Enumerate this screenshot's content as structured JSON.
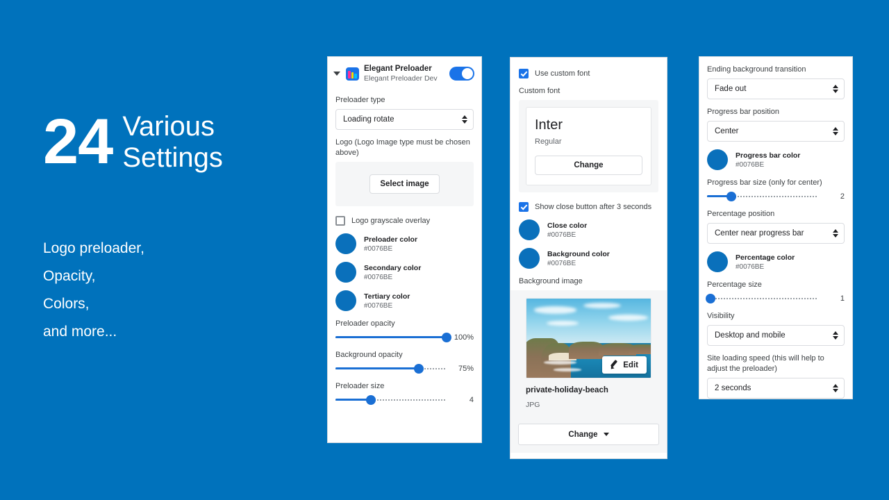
{
  "promo": {
    "number": "24",
    "title_line1": "Various",
    "title_line2": "Settings",
    "features": [
      "Logo preloader,",
      "Opacity,",
      "Colors,",
      "and more..."
    ]
  },
  "theme": {
    "background": "#0072BC",
    "accent": "#1a73e8",
    "swatch": "#0076BE"
  },
  "panel1": {
    "header": {
      "caret_icon": "chevron-down-icon",
      "app_icon": "elegant-preloader-icon",
      "title": "Elegant Preloader",
      "subtitle": "Elegant Preloader Dev",
      "toggle_state": "on"
    },
    "preloader_type": {
      "label": "Preloader type",
      "value": "Loading rotate"
    },
    "logo": {
      "label": "Logo (Logo Image type must be chosen above)",
      "button": "Select image"
    },
    "grayscale": {
      "label": "Logo grayscale overlay",
      "checked": false
    },
    "colors": [
      {
        "name": "Preloader color",
        "hex": "#0076BE"
      },
      {
        "name": "Secondary color",
        "hex": "#0076BE"
      },
      {
        "name": "Tertiary color",
        "hex": "#0076BE"
      }
    ],
    "sliders": [
      {
        "label": "Preloader opacity",
        "value": "100%",
        "percent": 100
      },
      {
        "label": "Background opacity",
        "value": "75%",
        "percent": 75
      },
      {
        "label": "Preloader size",
        "value": "4",
        "percent": 32
      }
    ]
  },
  "panel2": {
    "use_custom_font": {
      "label": "Use custom font",
      "checked": true
    },
    "custom_font": {
      "label": "Custom font",
      "name": "Inter",
      "style": "Regular",
      "change_button": "Change"
    },
    "show_close": {
      "label": "Show close button after 3 seconds",
      "checked": true
    },
    "colors": [
      {
        "name": "Close color",
        "hex": "#0076BE"
      },
      {
        "name": "Background color",
        "hex": "#0076BE"
      }
    ],
    "background_image": {
      "label": "Background image",
      "edit_button": "Edit",
      "file_name": "private-holiday-beach",
      "file_type": "JPG",
      "change_button": "Change"
    }
  },
  "panel3": {
    "ending_transition": {
      "label": "Ending background transition",
      "value": "Fade out"
    },
    "progress_position": {
      "label": "Progress bar position",
      "value": "Center"
    },
    "progress_color": {
      "name": "Progress bar color",
      "hex": "#0076BE"
    },
    "progress_size": {
      "label": "Progress bar size (only for center)",
      "value": "2",
      "percent": 22
    },
    "percentage_position": {
      "label": "Percentage position",
      "value": "Center near progress bar"
    },
    "percentage_color": {
      "name": "Percentage color",
      "hex": "#0076BE"
    },
    "percentage_size": {
      "label": "Percentage size",
      "value": "1",
      "percent": 3
    },
    "visibility": {
      "label": "Visibility",
      "value": "Desktop and mobile"
    },
    "loading_speed": {
      "label": "Site loading speed (this will help to adjust the preloader)",
      "value": "2 seconds"
    }
  }
}
